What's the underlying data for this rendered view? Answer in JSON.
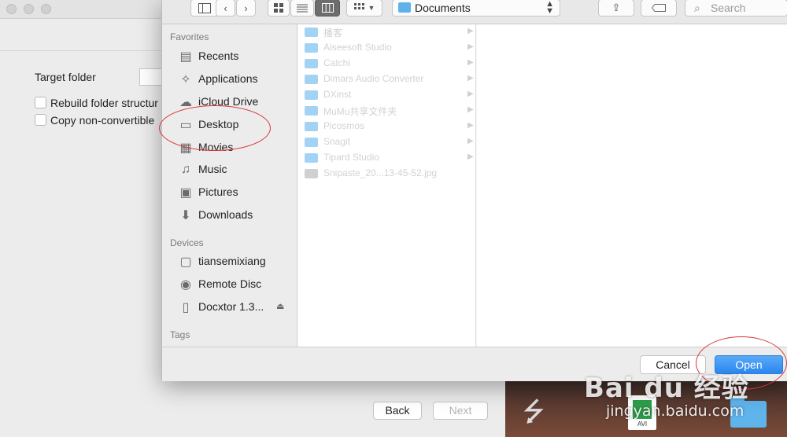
{
  "background_window": {
    "target_folder_label": "Target folder",
    "options": [
      {
        "label": "Rebuild folder structur"
      },
      {
        "label": "Copy non-convertible"
      }
    ],
    "back_button": "Back",
    "next_button": "Next"
  },
  "dialog": {
    "location": "Documents",
    "search_placeholder": "Search",
    "sidebar": {
      "favorites_header": "Favorites",
      "favorites": [
        {
          "label": "Recents",
          "icon": "recents-icon"
        },
        {
          "label": "Applications",
          "icon": "applications-icon"
        },
        {
          "label": "iCloud Drive",
          "icon": "cloud-icon"
        },
        {
          "label": "Desktop",
          "icon": "desktop-icon"
        },
        {
          "label": "Movies",
          "icon": "movies-icon"
        },
        {
          "label": "Music",
          "icon": "music-icon"
        },
        {
          "label": "Pictures",
          "icon": "camera-icon"
        },
        {
          "label": "Downloads",
          "icon": "download-icon"
        }
      ],
      "devices_header": "Devices",
      "devices": [
        {
          "label": "tiansemixiang",
          "icon": "computer-icon"
        },
        {
          "label": "Remote Disc",
          "icon": "disc-icon"
        },
        {
          "label": "Docxtor 1.3...",
          "icon": "drive-icon"
        }
      ],
      "tags_header": "Tags"
    },
    "files": [
      {
        "label": "播客",
        "type": "folder"
      },
      {
        "label": "Aiseesoft Studio",
        "type": "folder"
      },
      {
        "label": "Catchi",
        "type": "folder"
      },
      {
        "label": "Dimars Audio Converter",
        "type": "folder"
      },
      {
        "label": "DXinst",
        "type": "folder"
      },
      {
        "label": "MuMu共享文件夹",
        "type": "folder"
      },
      {
        "label": "Picosmos",
        "type": "folder"
      },
      {
        "label": "Snagit",
        "type": "folder"
      },
      {
        "label": "Tipard Studio",
        "type": "folder"
      },
      {
        "label": "Snipaste_20...13-45-52.jpg",
        "type": "image"
      }
    ],
    "cancel_button": "Cancel",
    "open_button": "Open"
  },
  "desktop": {
    "avi_label": "AVI"
  },
  "watermark": {
    "brand": "Bai du 经验",
    "url": "jingyan.baidu.com"
  },
  "colors": {
    "accent": "#2a86ee",
    "annotation": "#d93535"
  }
}
